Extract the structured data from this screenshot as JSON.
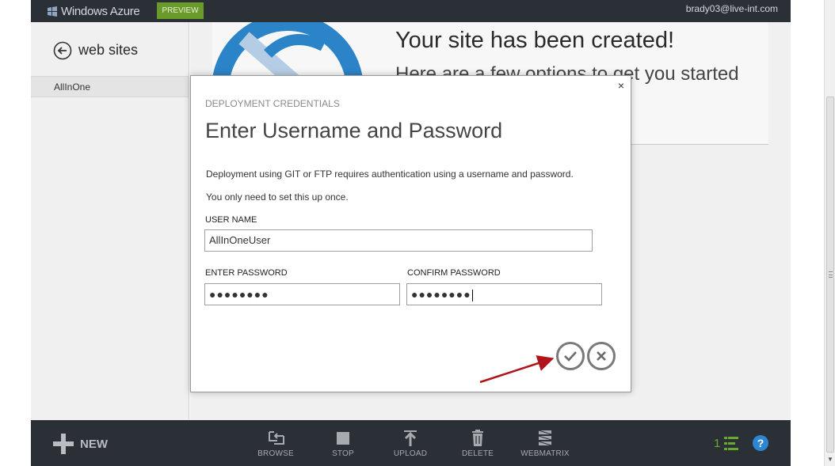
{
  "topbar": {
    "product_name": "Windows Azure",
    "preview_badge": "PREVIEW",
    "user_email": "brady03@live-int.com"
  },
  "leftnav": {
    "title": "web sites",
    "items": [
      {
        "label": "AllInOne"
      }
    ]
  },
  "main": {
    "hero_title": "Your site has been created!",
    "hero_subtitle": "Here are a few options to get you started"
  },
  "dialog": {
    "eyebrow": "DEPLOYMENT CREDENTIALS",
    "title": "Enter Username and Password",
    "description_line1": "Deployment using GIT or FTP requires authentication using a username and password.",
    "description_line2": "You only need to set this up once.",
    "username_label": "USER NAME",
    "username_value": "AllInOneUser",
    "password_label": "ENTER PASSWORD",
    "password_value": "●●●●●●●●",
    "confirm_label": "CONFIRM PASSWORD",
    "confirm_value": "●●●●●●●●",
    "close_glyph": "×"
  },
  "commandbar": {
    "new_label": "NEW",
    "commands": [
      {
        "label": "BROWSE",
        "icon": "browse-icon"
      },
      {
        "label": "STOP",
        "icon": "stop-icon"
      },
      {
        "label": "UPLOAD",
        "icon": "upload-icon"
      },
      {
        "label": "DELETE",
        "icon": "delete-icon"
      },
      {
        "label": "WEBMATRIX",
        "icon": "webmatrix-icon"
      }
    ],
    "notification_count": "1",
    "help_glyph": "?"
  },
  "colors": {
    "chrome_dark": "#2b2f36",
    "preview_green": "#6a9a2a",
    "annotation_arrow": "#b0151b",
    "help_blue": "#2d86d0",
    "notification_green": "#6aa82e"
  }
}
